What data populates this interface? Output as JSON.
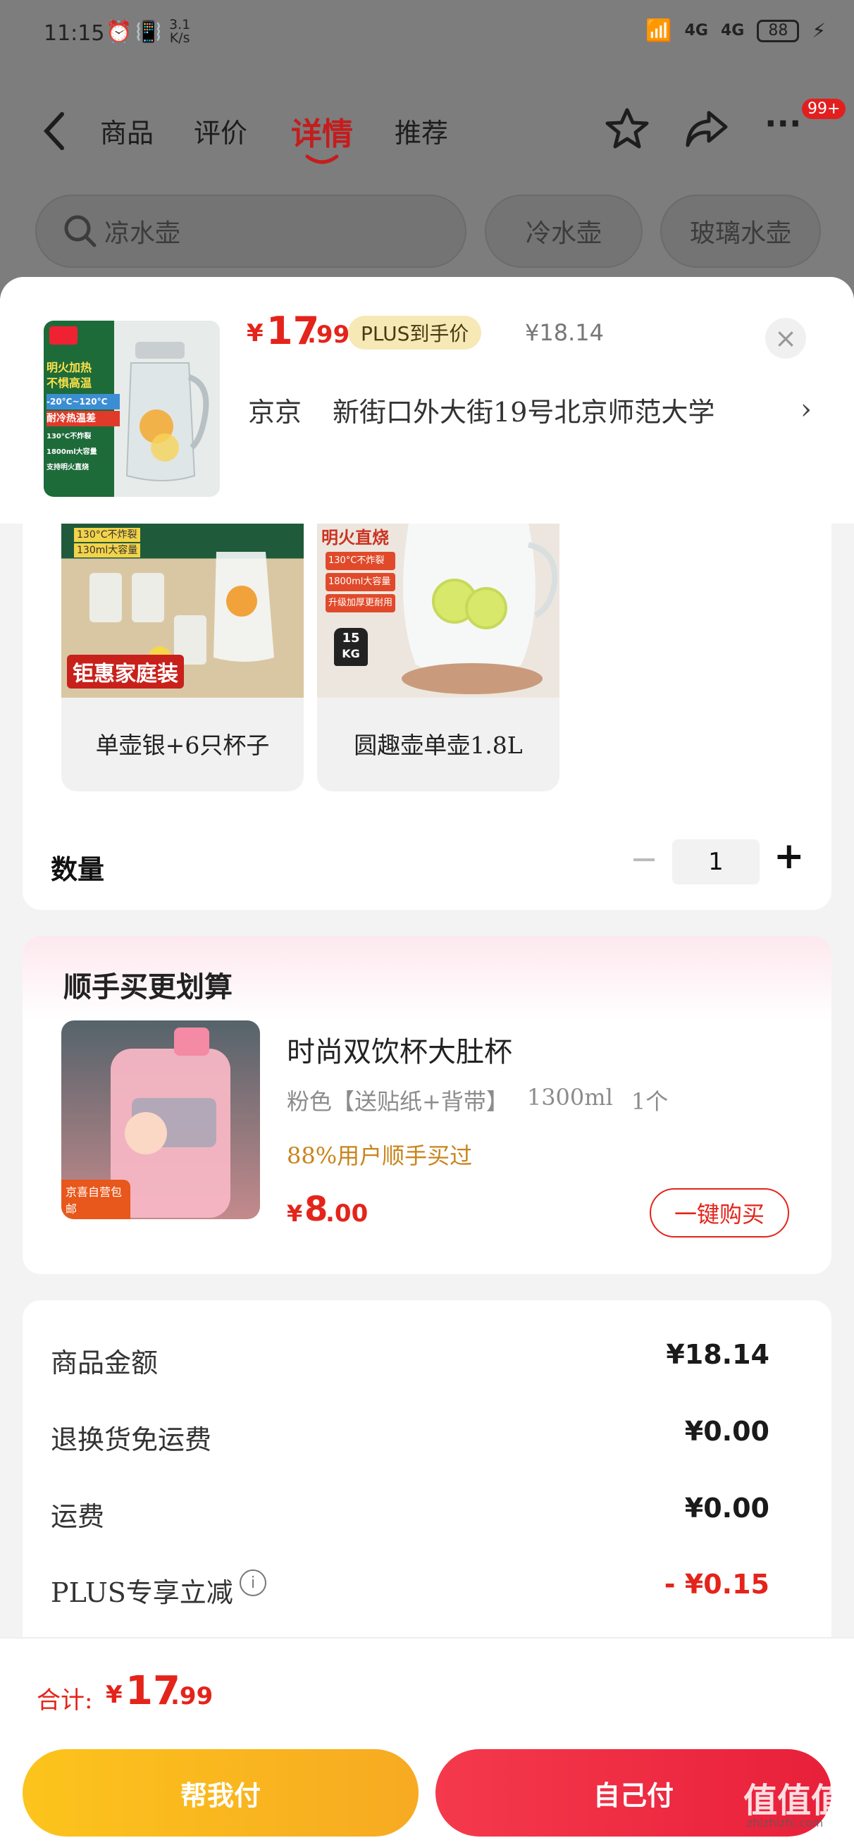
{
  "status_bar": {
    "time": "11:15",
    "net_speed_value": "3.1",
    "net_speed_unit": "K/s",
    "signal1": "4G",
    "signal2": "4G",
    "battery": "88"
  },
  "nav": {
    "tabs": [
      "商品",
      "评价",
      "详情",
      "推荐"
    ],
    "active_index": 2,
    "badge": "99+"
  },
  "search": {
    "placeholder": "凉水壶",
    "chips": [
      "冷水壶",
      "玻璃水壶"
    ]
  },
  "product": {
    "price_symbol": "¥",
    "price_int": "17",
    "price_dec": ".99",
    "plus_label": "PLUS到手价",
    "original_price": "¥18.14",
    "thumb_lines": [
      "明火加热",
      "不惧高温",
      "-20°C~120°C",
      "耐冷热温差",
      "130°C不炸裂",
      "1800ml大容量",
      "支持明火直烧"
    ],
    "address_name": "京京",
    "address": "新街口外大街19号北京师范大学"
  },
  "specs": [
    {
      "label": "单壶银+6只杯子",
      "img_lines": [
        "130°C不炸裂",
        "130ml大容量",
        "钜惠家庭装"
      ]
    },
    {
      "label": "圆趣壶单壶1.8L",
      "img_lines": [
        "明火直烧",
        "130°C不炸裂",
        "1800ml大容量",
        "升级加厚更耐用",
        "15",
        "KG"
      ]
    }
  ],
  "quantity": {
    "label": "数量",
    "value": "1",
    "minus": "−",
    "plus": "+"
  },
  "addon": {
    "title": "顺手买更划算",
    "name": "时尚双饮杯大肚杯",
    "spec": "粉色【送贴纸+背带】",
    "volume": "1300ml",
    "count": "1个",
    "social": "88%用户顺手买过",
    "price_symbol": "¥",
    "price_int": "8",
    "price_dec": ".00",
    "buy_label": "一键购买",
    "img_tag": "京喜自营包邮"
  },
  "summary": [
    {
      "label": "商品金额",
      "value": "¥18.14"
    },
    {
      "label": "退换货免运费",
      "value": "¥0.00"
    },
    {
      "label": "运费",
      "value": "¥0.00"
    },
    {
      "label": "PLUS专享立减",
      "value": "- ¥0.15"
    }
  ],
  "footer": {
    "total_label": "合计:",
    "total_symbol": "¥",
    "total_int": "17",
    "total_dec": ".99",
    "help_pay": "帮我付",
    "self_pay": "自己付",
    "watermark": "值值值",
    "watermark_sub": "zhizhizhi.com"
  },
  "colors": {
    "accent": "#e4241b",
    "help_pay": "#fcbd1e",
    "self_pay": "#f02d42"
  }
}
